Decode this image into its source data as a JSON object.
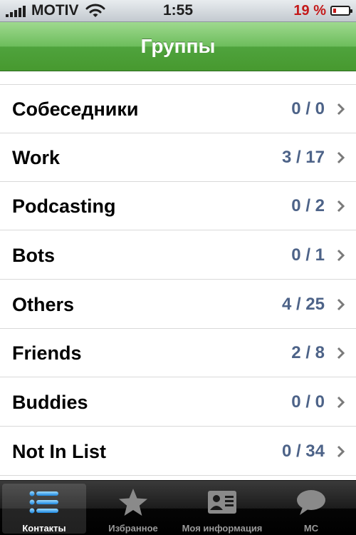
{
  "status_bar": {
    "carrier": "MOTIV",
    "time": "1:55",
    "battery_percent": "19 %"
  },
  "nav": {
    "title": "Группы"
  },
  "groups": [
    {
      "name": "Собеседники",
      "count": "0 / 0"
    },
    {
      "name": "Work",
      "count": "3 / 17"
    },
    {
      "name": "Podcasting",
      "count": "0 / 2"
    },
    {
      "name": "Bots",
      "count": "0 / 1"
    },
    {
      "name": "Others",
      "count": "4 / 25"
    },
    {
      "name": "Friends",
      "count": "2 / 8"
    },
    {
      "name": "Buddies",
      "count": "0 / 0"
    },
    {
      "name": "Not In List",
      "count": "0 / 34"
    }
  ],
  "tabs": [
    {
      "label": "Контакты",
      "icon": "list-icon",
      "selected": true
    },
    {
      "label": "Избранное",
      "icon": "star-icon",
      "selected": false
    },
    {
      "label": "Моя информация",
      "icon": "contact-card-icon",
      "selected": false
    },
    {
      "label": "МС",
      "icon": "chat-bubble-icon",
      "selected": false
    }
  ],
  "colors": {
    "nav_green": "#4fa33d",
    "count_blue": "#4d6388",
    "battery_low": "#c41a1a"
  }
}
